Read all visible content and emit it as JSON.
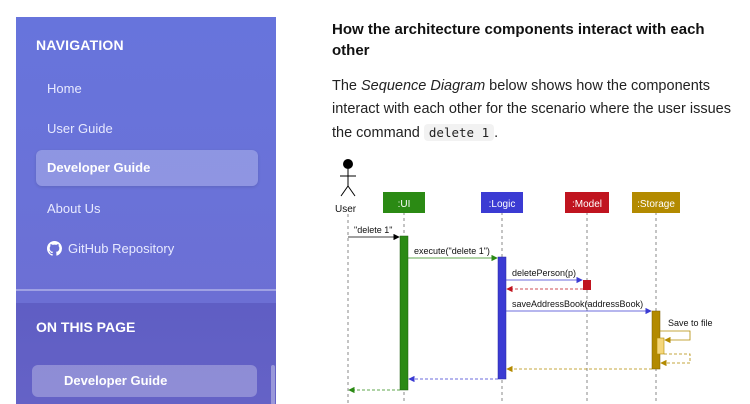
{
  "sidebar": {
    "nav_heading": "NAVIGATION",
    "items": [
      {
        "label": "Home"
      },
      {
        "label": "User Guide"
      },
      {
        "label": "Developer Guide"
      },
      {
        "label": "About Us"
      },
      {
        "label": "GitHub Repository"
      }
    ],
    "on_this_page_heading": "ON THIS PAGE",
    "on_this_page_items": [
      {
        "label": "Developer Guide"
      }
    ]
  },
  "content": {
    "section_title": "How the architecture components interact with each other",
    "para_prefix": "The ",
    "para_em": "Sequence Diagram",
    "para_middle": " below shows how the components interact with each other for the scenario where the user issues the command ",
    "para_code": "delete 1",
    "para_suffix": "."
  },
  "diagram": {
    "actor": "User",
    "participants": [
      {
        "label": ":UI",
        "color": "#2b8a14"
      },
      {
        "label": ":Logic",
        "color": "#3b3bd3"
      },
      {
        "label": ":Model",
        "color": "#c0141f"
      },
      {
        "label": ":Storage",
        "color": "#b38a00"
      }
    ],
    "messages": [
      "\"delete 1\"",
      "execute(\"delete 1\")",
      "deletePerson(p)",
      "saveAddressBook(addressBook)",
      "Save to file"
    ]
  }
}
